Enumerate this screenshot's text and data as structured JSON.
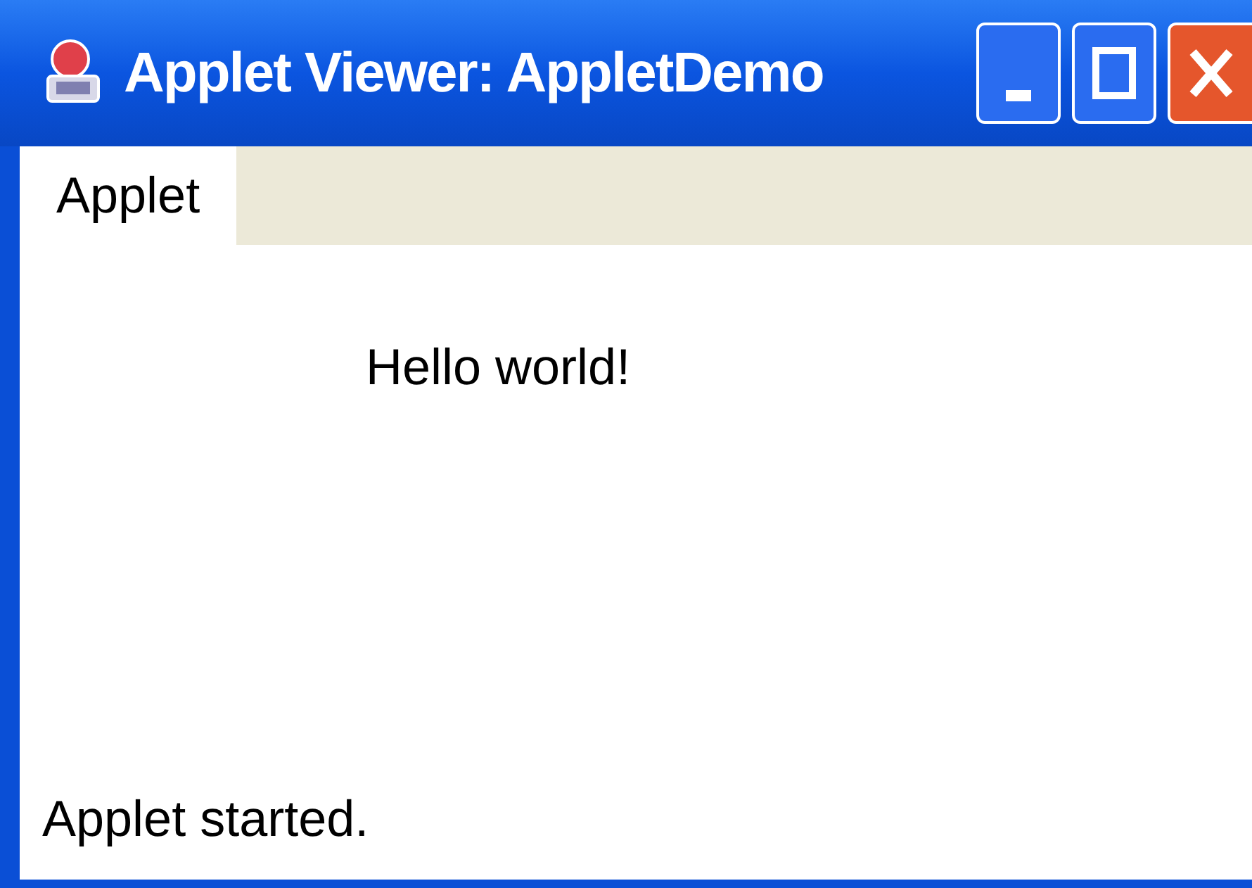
{
  "window": {
    "title": "Applet Viewer: AppletDemo"
  },
  "menu": [
    {
      "label": "Applet"
    }
  ],
  "content": {
    "text": "Hello world!"
  },
  "status_bar": "Applet started."
}
